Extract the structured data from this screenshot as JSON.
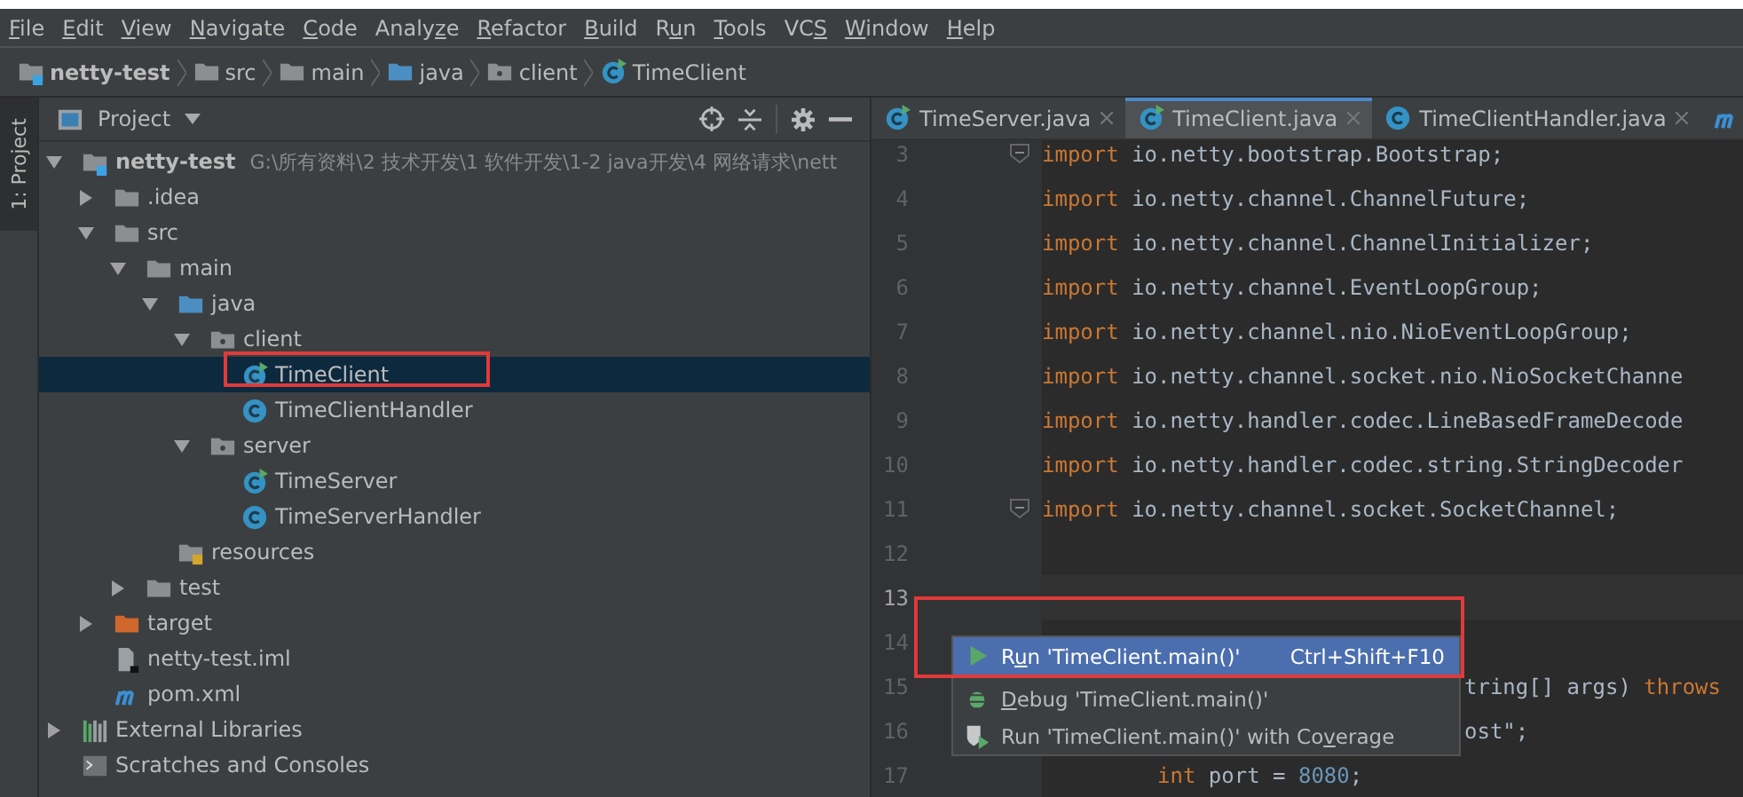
{
  "menu_bar": [
    {
      "key": "F",
      "after": "ile"
    },
    {
      "key": "E",
      "after": "dit"
    },
    {
      "key": "V",
      "after": "iew"
    },
    {
      "key": "N",
      "after": "avigate"
    },
    {
      "key": "C",
      "after": "ode"
    },
    {
      "before": "Analy",
      "key": "z",
      "after": "e"
    },
    {
      "key": "R",
      "after": "efactor"
    },
    {
      "key": "B",
      "after": "uild"
    },
    {
      "before": "R",
      "key": "u",
      "after": "n"
    },
    {
      "key": "T",
      "after": "ools"
    },
    {
      "before": "VC",
      "key": "S"
    },
    {
      "key": "W",
      "after": "indow"
    },
    {
      "key": "H",
      "after": "elp"
    }
  ],
  "breadcrumbs": [
    {
      "label": "netty-test",
      "kind": "module"
    },
    {
      "label": "src",
      "kind": "folder"
    },
    {
      "label": "main",
      "kind": "folder"
    },
    {
      "label": "java",
      "kind": "source"
    },
    {
      "label": "client",
      "kind": "package"
    },
    {
      "label": "TimeClient",
      "kind": "class-run"
    }
  ],
  "side_tab": {
    "label": "1: Project",
    "selected": true
  },
  "project_panel": {
    "title": "Project",
    "tree": [
      {
        "label": "netty-test",
        "kind": "module",
        "hint": "G:\\所有资料\\2 技术开发\\1 软件开发\\1-2 java开发\\4 网络请求\\nett",
        "expanded": true,
        "selected": false,
        "children": [
          {
            "label": ".idea",
            "kind": "folder",
            "expanded": false,
            "selected": false
          },
          {
            "label": "src",
            "kind": "folder",
            "expanded": true,
            "selected": false,
            "children": [
              {
                "label": "main",
                "kind": "folder",
                "expanded": true,
                "selected": false,
                "children": [
                  {
                    "label": "java",
                    "kind": "source",
                    "expanded": true,
                    "selected": false,
                    "children": [
                      {
                        "label": "client",
                        "kind": "package",
                        "expanded": true,
                        "selected": false,
                        "children": [
                          {
                            "label": "TimeClient",
                            "kind": "class-run",
                            "selected": true,
                            "highlighted": true
                          },
                          {
                            "label": "TimeClientHandler",
                            "kind": "class",
                            "selected": false
                          }
                        ]
                      },
                      {
                        "label": "server",
                        "kind": "package",
                        "expanded": true,
                        "selected": false,
                        "children": [
                          {
                            "label": "TimeServer",
                            "kind": "class-run",
                            "selected": false
                          },
                          {
                            "label": "TimeServerHandler",
                            "kind": "class",
                            "selected": false
                          }
                        ]
                      }
                    ]
                  },
                  {
                    "label": "resources",
                    "kind": "resources",
                    "selected": false
                  }
                ]
              },
              {
                "label": "test",
                "kind": "folder",
                "expanded": false,
                "selected": false
              }
            ]
          },
          {
            "label": "target",
            "kind": "excluded",
            "expanded": false,
            "selected": false
          },
          {
            "label": "netty-test.iml",
            "kind": "iml",
            "selected": false
          },
          {
            "label": "pom.xml",
            "kind": "maven",
            "selected": false
          }
        ]
      },
      {
        "label": "External Libraries",
        "kind": "libraries",
        "expanded": false,
        "selected": false
      },
      {
        "label": "Scratches and Consoles",
        "kind": "scratches",
        "selected": false
      }
    ]
  },
  "editor_tabs": [
    {
      "label": "TimeServer.java",
      "kind": "class-run",
      "selected": false
    },
    {
      "label": "TimeClient.java",
      "kind": "class-run",
      "selected": true
    },
    {
      "label": "TimeClientHandler.java",
      "kind": "class",
      "selected": false
    },
    {
      "kind": "maven",
      "selected": false
    }
  ],
  "code_lines": [
    {
      "number": "3",
      "fold": true,
      "current": false,
      "tokens": [
        {
          "kind": "keyword",
          "text": "import"
        },
        {
          "kind": "plain",
          "text": " io.netty.bootstrap.Bootstrap;"
        }
      ]
    },
    {
      "number": "4",
      "fold": false,
      "current": false,
      "tokens": [
        {
          "kind": "keyword",
          "text": "import"
        },
        {
          "kind": "plain",
          "text": " io.netty.channel.ChannelFuture;"
        }
      ]
    },
    {
      "number": "5",
      "fold": false,
      "current": false,
      "tokens": [
        {
          "kind": "keyword",
          "text": "import"
        },
        {
          "kind": "plain",
          "text": " io.netty.channel.ChannelInitializer;"
        }
      ]
    },
    {
      "number": "6",
      "fold": false,
      "current": false,
      "tokens": [
        {
          "kind": "keyword",
          "text": "import"
        },
        {
          "kind": "plain",
          "text": " io.netty.channel.EventLoopGroup;"
        }
      ]
    },
    {
      "number": "7",
      "fold": false,
      "current": false,
      "tokens": [
        {
          "kind": "keyword",
          "text": "import"
        },
        {
          "kind": "plain",
          "text": " io.netty.channel.nio.NioEventLoopGroup;"
        }
      ]
    },
    {
      "number": "8",
      "fold": false,
      "current": false,
      "tokens": [
        {
          "kind": "keyword",
          "text": "import"
        },
        {
          "kind": "plain",
          "text": " io.netty.channel.socket.nio.NioSocketChanne"
        }
      ]
    },
    {
      "number": "9",
      "fold": false,
      "current": false,
      "tokens": [
        {
          "kind": "keyword",
          "text": "import"
        },
        {
          "kind": "plain",
          "text": " io.netty.handler.codec.LineBasedFrameDecode"
        }
      ]
    },
    {
      "number": "10",
      "fold": false,
      "current": false,
      "tokens": [
        {
          "kind": "keyword",
          "text": "import"
        },
        {
          "kind": "plain",
          "text": " io.netty.handler.codec.string.StringDecoder"
        }
      ]
    },
    {
      "number": "11",
      "fold": true,
      "current": false,
      "tokens": [
        {
          "kind": "keyword",
          "text": "import"
        },
        {
          "kind": "plain",
          "text": " io.netty.channel.socket.SocketChannel;"
        }
      ]
    },
    {
      "number": "12",
      "fold": false,
      "current": false
    },
    {
      "number": "13",
      "fold": false,
      "current": true
    },
    {
      "number": "14",
      "fold": false,
      "current": false
    },
    {
      "number": "15",
      "current": false,
      "kind": "covered",
      "tokens": [
        {
          "kind": "plain",
          "text": "tring[] args) "
        },
        {
          "kind": "keyword",
          "text": "throws"
        }
      ]
    },
    {
      "number": "16",
      "current": false,
      "kind": "covered",
      "tokens": [
        {
          "kind": "plain",
          "text": "ost\";"
        }
      ]
    },
    {
      "number": "17",
      "fold": false,
      "current": false,
      "kind": "indented",
      "tokens": [
        {
          "kind": "keyword",
          "text": "int"
        },
        {
          "kind": "plain",
          "text": " port = "
        },
        {
          "kind": "number",
          "text": "8080"
        },
        {
          "kind": "plain",
          "text": ";"
        }
      ]
    }
  ],
  "run_popup": [
    {
      "before": "R",
      "key": "u",
      "after": "n 'TimeClient.main()'",
      "shortcut": "Ctrl+Shift+F10",
      "kind": "run",
      "selected": true,
      "highlighted": true
    },
    {
      "key": "D",
      "after": "ebug 'TimeClient.main()'",
      "kind": "debug",
      "selected": false
    },
    {
      "before": "Run 'TimeClient.main()' with Co",
      "key": "v",
      "after": "erage",
      "kind": "coverage",
      "selected": false
    }
  ]
}
